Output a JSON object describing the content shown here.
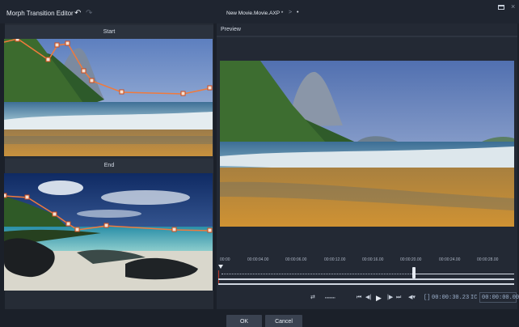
{
  "titlebar": {
    "title": "Morph Transition Editor",
    "undo_icon": "↶",
    "redo_icon": "↷",
    "document": "New Movie.Movie.AXP *",
    "separator": ">",
    "dot": "•",
    "close_glyph": "×"
  },
  "left_panel": {
    "start_label": "Start",
    "end_label": "End"
  },
  "preview": {
    "label": "Preview"
  },
  "timeline": {
    "ticks": [
      "00:00",
      "00:00:04.00",
      "00:00:06.00",
      "00:00:12.00",
      "00:00:16.00",
      "00:00:20.00",
      "00:00:24.00",
      "00:00:28.00"
    ],
    "playhead_progress": 0.66
  },
  "controls": {
    "loop_icon": "⇄",
    "volume": "▪▪▪▪▪▪▪▪▪",
    "first": "⏮",
    "prev": "◀|",
    "play": "▶",
    "next": "|▶",
    "last": "⏭",
    "volume_menu": "◀▾",
    "duration_marker": "[]",
    "duration": "00:00:30.23",
    "tc_marker": "IC",
    "timecode": "00:00:00.00"
  },
  "buttons": {
    "ok": "OK",
    "cancel": "Cancel"
  },
  "colors": {
    "background": "#1b2029",
    "panel": "#262c36",
    "morph_line": "#f07a3c"
  }
}
